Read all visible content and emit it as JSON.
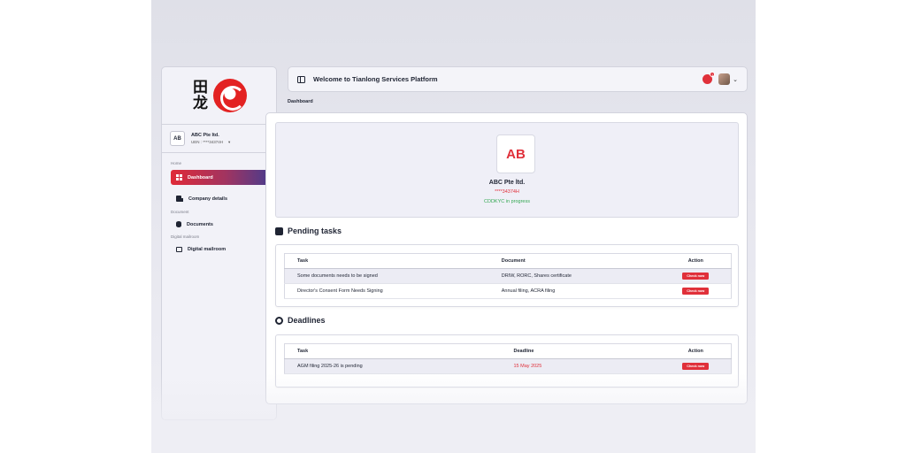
{
  "logo": {
    "kanji_top": "田",
    "kanji_bottom": "龙"
  },
  "sidebar": {
    "company": {
      "initials": "AB",
      "name": "ABC Pte ltd.",
      "uen": "UEN : ****34374H",
      "caret": "▾"
    },
    "sections": {
      "home": "Home",
      "document": "Document",
      "mailroom": "Digital mailroom"
    },
    "items": [
      {
        "label": "Dashboard"
      },
      {
        "label": "Company details"
      },
      {
        "label": "Documents"
      },
      {
        "label": "Digital mailroom"
      }
    ]
  },
  "header": {
    "title": "Welcome to Tianlong Services Platform",
    "notification_count": "1",
    "chevron": "⌄"
  },
  "breadcrumb": "Dashboard",
  "profile": {
    "initials": "AB",
    "name": "ABC Pte ltd.",
    "uen": "****34374H",
    "status": "CDDKYC in progress"
  },
  "pending": {
    "title": "Pending tasks",
    "columns": [
      "Task",
      "Document",
      "Action"
    ],
    "rows": [
      {
        "task": "Some documents needs to be signed",
        "document": "DRIW, RORC, Shares certificate",
        "action": "Check now"
      },
      {
        "task": "Director's Consent Form Needs Signing",
        "document": "Annual filing, ACRA filing",
        "action": "Check now"
      }
    ]
  },
  "deadlines": {
    "title": "Deadlines",
    "columns": [
      "Task",
      "Deadline",
      "Action"
    ],
    "rows": [
      {
        "task": "AGM filing 2025-26 is pending",
        "deadline": "15 May 2025",
        "action": "Check now"
      }
    ]
  },
  "colors": {
    "accent": "#e0303a",
    "success": "#35a853",
    "sidebar_gradient_end": "#4a3b8c"
  },
  "icons": [
    "sidebar-toggle-icon",
    "bell-icon",
    "chevron-down-icon",
    "dashboard-grid-icon",
    "building-icon",
    "database-icon",
    "inbox-icon"
  ]
}
